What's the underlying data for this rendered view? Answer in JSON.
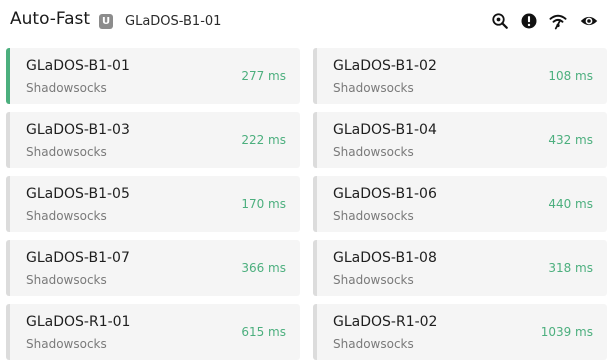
{
  "header": {
    "group_name": "Auto-Fast",
    "type_badge": "U",
    "selected_proxy": "GLaDOS-B1-01",
    "icons": [
      "location-search-icon",
      "alert-icon",
      "wifi-icon",
      "eye-icon"
    ]
  },
  "accent_color": "#4caf7e",
  "proxies": [
    {
      "name": "GLaDOS-B1-01",
      "protocol": "Shadowsocks",
      "delay": "277 ms",
      "selected": true
    },
    {
      "name": "GLaDOS-B1-02",
      "protocol": "Shadowsocks",
      "delay": "108 ms",
      "selected": false
    },
    {
      "name": "GLaDOS-B1-03",
      "protocol": "Shadowsocks",
      "delay": "222 ms",
      "selected": false
    },
    {
      "name": "GLaDOS-B1-04",
      "protocol": "Shadowsocks",
      "delay": "432 ms",
      "selected": false
    },
    {
      "name": "GLaDOS-B1-05",
      "protocol": "Shadowsocks",
      "delay": "170 ms",
      "selected": false
    },
    {
      "name": "GLaDOS-B1-06",
      "protocol": "Shadowsocks",
      "delay": "440 ms",
      "selected": false
    },
    {
      "name": "GLaDOS-B1-07",
      "protocol": "Shadowsocks",
      "delay": "366 ms",
      "selected": false
    },
    {
      "name": "GLaDOS-B1-08",
      "protocol": "Shadowsocks",
      "delay": "318 ms",
      "selected": false
    },
    {
      "name": "GLaDOS-R1-01",
      "protocol": "Shadowsocks",
      "delay": "615 ms",
      "selected": false
    },
    {
      "name": "GLaDOS-R1-02",
      "protocol": "Shadowsocks",
      "delay": "1039 ms",
      "selected": false
    }
  ]
}
